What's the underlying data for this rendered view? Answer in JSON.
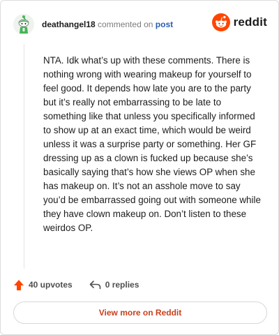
{
  "comment": {
    "username": "deathangel18",
    "action_text": "commented on",
    "target_link": "post",
    "body": "NTA. Idk what’s up with these comments. There is nothing wrong with wearing makeup for yourself to feel good. It depends how late you are to the party but it’s really not embarrassing to be late to something like that unless you specifically informed to show up at an exact time, which would be weird unless it was a surprise party or something. Her GF dressing up as a clown is fucked up because she’s basically saying that’s how she views OP when she has makeup on. It’s not an asshole move to say you’d be embarrassed going out with someone while they have clown makeup on. Don’t listen to these weirdos OP.",
    "upvotes_label": "40 upvotes",
    "replies_label": "0 replies"
  },
  "brand": {
    "logo_text": "reddit",
    "logo_icon": "reddit-alien-icon",
    "brand_color": "#FF4500"
  },
  "footer": {
    "view_more_label": "View more on Reddit"
  },
  "colors": {
    "upvote": "#FF4500",
    "link": "#2a5db0",
    "view_more_text": "#c9401a"
  },
  "icons": {
    "avatar": "snoo-avatar-icon",
    "upvote": "upvote-arrow-icon",
    "reply": "reply-arrow-icon"
  }
}
